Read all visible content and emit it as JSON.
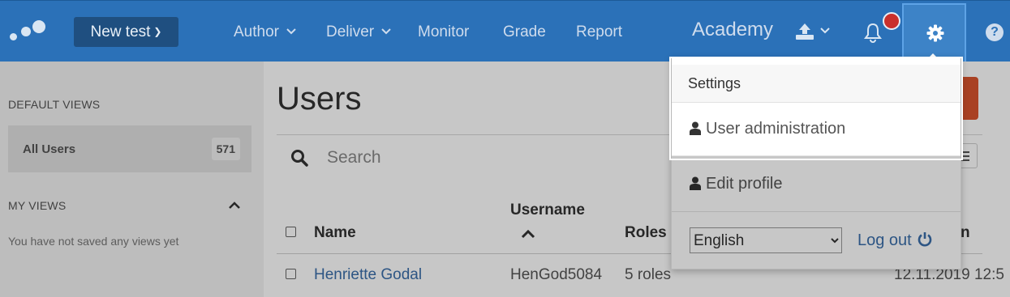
{
  "nav": {
    "new_test": "New test",
    "author": "Author",
    "deliver": "Deliver",
    "monitor": "Monitor",
    "grade": "Grade",
    "report": "Report",
    "org": "Academy"
  },
  "sidebar": {
    "default_views": "DEFAULT VIEWS",
    "all_users": "All Users",
    "all_users_count": "571",
    "my_views": "MY VIEWS",
    "no_views": "You have not saved any views yet"
  },
  "main": {
    "title": "Users",
    "search_placeholder": "Search",
    "columns": {
      "name": "Name",
      "username": "Username",
      "roles": "Roles",
      "last_col_fragment": "n"
    },
    "rows": [
      {
        "name": "Henriette Godal",
        "username": "HenGod5084",
        "roles": "5 roles",
        "date": "12.11.2019 12:5"
      }
    ]
  },
  "settings_menu": {
    "header": "Settings",
    "user_admin": "User administration",
    "edit_profile": "Edit profile",
    "language": "English",
    "logout": "Log out"
  },
  "colors": {
    "topbar": "#2b71b8",
    "accent_orange": "#d9542d",
    "link": "#3a6ea9",
    "notification": "#c9302c"
  },
  "icons": [
    "logo-icon",
    "chevron-down-icon",
    "upload-icon",
    "bell-icon",
    "gear-icon",
    "help-icon",
    "search-icon",
    "user-icon",
    "power-icon",
    "chevron-up-icon",
    "list-icon"
  ]
}
